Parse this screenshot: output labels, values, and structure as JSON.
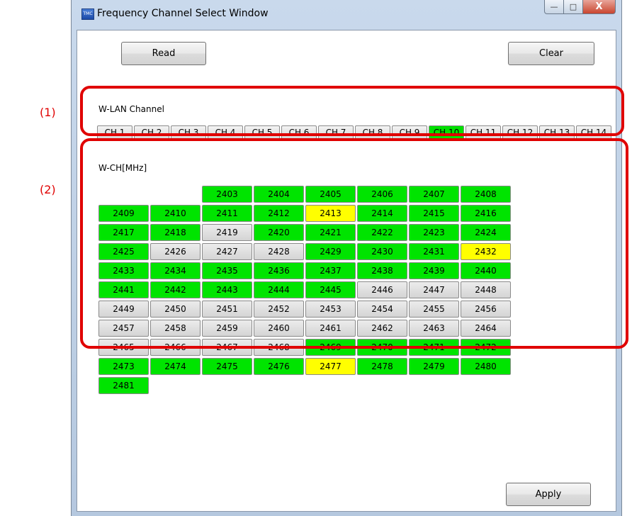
{
  "annotations": {
    "box1": "(1)",
    "box2": "(2)"
  },
  "window": {
    "icon_text": "TMC",
    "title": "Frequency Channel Select Window",
    "min_glyph": "—",
    "max_glyph": "□",
    "close_glyph": "X"
  },
  "toolbar": {
    "read_label": "Read",
    "clear_label": "Clear"
  },
  "wlan": {
    "label": "W-LAN Channel",
    "channels": [
      "CH 1",
      "CH 2",
      "CH 3",
      "CH 4",
      "CH 5",
      "CH 6",
      "CH 7",
      "CH 8",
      "CH 9",
      "CH 10",
      "CH 11",
      "CH 12",
      "CH 13",
      "CH 14"
    ],
    "selected": "CH 10"
  },
  "wch": {
    "label": "W-CH[MHz]",
    "leading_blanks": 2,
    "cells": [
      {
        "f": "2403",
        "s": "g"
      },
      {
        "f": "2404",
        "s": "g"
      },
      {
        "f": "2405",
        "s": "g"
      },
      {
        "f": "2406",
        "s": "g"
      },
      {
        "f": "2407",
        "s": "g"
      },
      {
        "f": "2408",
        "s": "g"
      },
      {
        "f": "2409",
        "s": "g"
      },
      {
        "f": "2410",
        "s": "g"
      },
      {
        "f": "2411",
        "s": "g"
      },
      {
        "f": "2412",
        "s": "g"
      },
      {
        "f": "2413",
        "s": "y"
      },
      {
        "f": "2414",
        "s": "g"
      },
      {
        "f": "2415",
        "s": "g"
      },
      {
        "f": "2416",
        "s": "g"
      },
      {
        "f": "2417",
        "s": "g"
      },
      {
        "f": "2418",
        "s": "g"
      },
      {
        "f": "2419",
        "s": "n"
      },
      {
        "f": "2420",
        "s": "g"
      },
      {
        "f": "2421",
        "s": "g"
      },
      {
        "f": "2422",
        "s": "g"
      },
      {
        "f": "2423",
        "s": "g"
      },
      {
        "f": "2424",
        "s": "g"
      },
      {
        "f": "2425",
        "s": "g"
      },
      {
        "f": "2426",
        "s": "n"
      },
      {
        "f": "2427",
        "s": "n"
      },
      {
        "f": "2428",
        "s": "n"
      },
      {
        "f": "2429",
        "s": "g"
      },
      {
        "f": "2430",
        "s": "g"
      },
      {
        "f": "2431",
        "s": "g"
      },
      {
        "f": "2432",
        "s": "y"
      },
      {
        "f": "2433",
        "s": "g"
      },
      {
        "f": "2434",
        "s": "g"
      },
      {
        "f": "2435",
        "s": "g"
      },
      {
        "f": "2436",
        "s": "g"
      },
      {
        "f": "2437",
        "s": "g"
      },
      {
        "f": "2438",
        "s": "g"
      },
      {
        "f": "2439",
        "s": "g"
      },
      {
        "f": "2440",
        "s": "g"
      },
      {
        "f": "2441",
        "s": "g"
      },
      {
        "f": "2442",
        "s": "g"
      },
      {
        "f": "2443",
        "s": "g"
      },
      {
        "f": "2444",
        "s": "g"
      },
      {
        "f": "2445",
        "s": "g"
      },
      {
        "f": "2446",
        "s": "n"
      },
      {
        "f": "2447",
        "s": "n"
      },
      {
        "f": "2448",
        "s": "n"
      },
      {
        "f": "2449",
        "s": "n"
      },
      {
        "f": "2450",
        "s": "n"
      },
      {
        "f": "2451",
        "s": "n"
      },
      {
        "f": "2452",
        "s": "n"
      },
      {
        "f": "2453",
        "s": "n"
      },
      {
        "f": "2454",
        "s": "n"
      },
      {
        "f": "2455",
        "s": "n"
      },
      {
        "f": "2456",
        "s": "n"
      },
      {
        "f": "2457",
        "s": "n"
      },
      {
        "f": "2458",
        "s": "n"
      },
      {
        "f": "2459",
        "s": "n"
      },
      {
        "f": "2460",
        "s": "n"
      },
      {
        "f": "2461",
        "s": "n"
      },
      {
        "f": "2462",
        "s": "n"
      },
      {
        "f": "2463",
        "s": "n"
      },
      {
        "f": "2464",
        "s": "n"
      },
      {
        "f": "2465",
        "s": "n"
      },
      {
        "f": "2466",
        "s": "n"
      },
      {
        "f": "2467",
        "s": "n"
      },
      {
        "f": "2468",
        "s": "n"
      },
      {
        "f": "2469",
        "s": "g"
      },
      {
        "f": "2470",
        "s": "g"
      },
      {
        "f": "2471",
        "s": "g"
      },
      {
        "f": "2472",
        "s": "g"
      },
      {
        "f": "2473",
        "s": "g"
      },
      {
        "f": "2474",
        "s": "g"
      },
      {
        "f": "2475",
        "s": "g"
      },
      {
        "f": "2476",
        "s": "g"
      },
      {
        "f": "2477",
        "s": "y"
      },
      {
        "f": "2478",
        "s": "g"
      },
      {
        "f": "2479",
        "s": "g"
      },
      {
        "f": "2480",
        "s": "g"
      },
      {
        "f": "2481",
        "s": "g"
      }
    ]
  },
  "footer": {
    "apply_label": "Apply"
  },
  "colors": {
    "selected_green": "#00e400",
    "warning_yellow": "#ffff00",
    "annotation_red": "#e00000"
  }
}
